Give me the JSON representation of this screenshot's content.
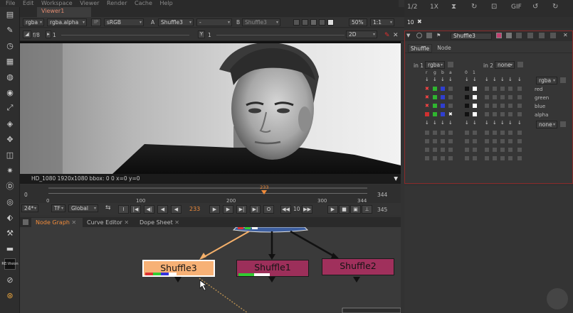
{
  "menu": [
    "File",
    "Edit",
    "Workspace",
    "Viewer",
    "Render",
    "Cache",
    "Help"
  ],
  "viewer_tab": "Viewer1",
  "properties_tab": "Properties",
  "viewer_controls": {
    "channels": "rgba",
    "alpha": "rgba.alpha",
    "ip": "IP",
    "colorspace": "sRGB",
    "a_label": "A",
    "a_input": "Shuffle3",
    "dash": "-",
    "b_label": "B",
    "b_input": "Shuffle3",
    "zoom": "50%",
    "ratio": "1:1",
    "view": "2D",
    "fstop": "f/8",
    "frame_small": "1",
    "y_label": "Y",
    "y_value": "1"
  },
  "image_info": "HD_1080 1920x1080  bbox: 0 0  x=0 y=0",
  "timeline": {
    "ticks": [
      "0",
      "100",
      "200",
      "300",
      "344"
    ],
    "left_num": "0",
    "right_num": "344",
    "current_frame": "233",
    "playhead_fraction": 0.677
  },
  "playback": {
    "fps": "24*",
    "tf": "TF",
    "global": "Global",
    "current": "233",
    "step": "10",
    "end": "345",
    "in_label": "I",
    "out_label": "O"
  },
  "node_tabs": [
    "Node Graph",
    "Curve Editor",
    "Dope Sheet"
  ],
  "nodes": [
    {
      "name": "Shuffle3",
      "selected": true,
      "color": "#f7b176"
    },
    {
      "name": "Shuffle1",
      "selected": false,
      "color": "#9c2f5a"
    },
    {
      "name": "Shuffle2",
      "selected": false,
      "color": "#a0305c"
    }
  ],
  "right_top": {
    "ratio": "1/2",
    "num1": "10",
    "zoom": "1X",
    "gif": "GIF"
  },
  "right_tab": {
    "count": "10"
  },
  "properties": {
    "node_name": "Shuffle3",
    "tabs": [
      "Shuffle",
      "Node"
    ],
    "in1_label": "in 1",
    "in1_value": "rgba",
    "in2_label": "in 2",
    "in2_value": "none",
    "col_labels": [
      "r",
      "g",
      "b",
      "a",
      "0",
      "1"
    ],
    "out_select": "rgba",
    "out_select2": "none",
    "outputs": [
      "red",
      "green",
      "blue",
      "alpha"
    ]
  },
  "colors": {
    "accent_orange": "#f08b3a",
    "selected_node": "#f7b176",
    "node_magenta": "#9c2f5a",
    "panel_border": "#8a2a2a"
  }
}
